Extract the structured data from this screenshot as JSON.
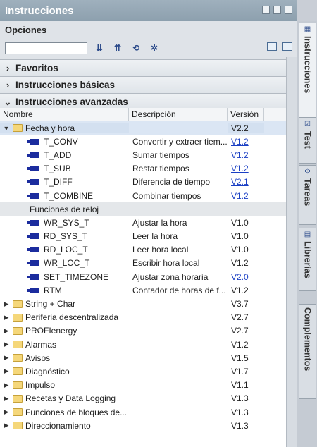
{
  "panel": {
    "title": "Instrucciones"
  },
  "options": {
    "label": "Opciones",
    "search_placeholder": ""
  },
  "panes": [
    {
      "label": "Favoritos",
      "expanded": false
    },
    {
      "label": "Instrucciones básicas",
      "expanded": false
    },
    {
      "label": "Instrucciones avanzadas",
      "expanded": true
    }
  ],
  "columns": {
    "name": "Nombre",
    "desc": "Descripción",
    "ver": "Versión"
  },
  "rows": [
    {
      "kind": "folder",
      "open": true,
      "name": "Fecha y hora",
      "desc": "",
      "ver": "V2.2",
      "link": false,
      "selected": true
    },
    {
      "kind": "block",
      "name": "T_CONV",
      "desc": "Convertir y extraer tiem...",
      "ver": "V1.2",
      "link": true
    },
    {
      "kind": "block",
      "name": "T_ADD",
      "desc": "Sumar tiempos",
      "ver": "V1.2",
      "link": true
    },
    {
      "kind": "block",
      "name": "T_SUB",
      "desc": "Restar tiempos",
      "ver": "V1.2",
      "link": true
    },
    {
      "kind": "block",
      "name": "T_DIFF",
      "desc": "Diferencia de tiempo",
      "ver": "V2.1",
      "link": true
    },
    {
      "kind": "block",
      "name": "T_COMBINE",
      "desc": "Combinar tiempos",
      "ver": "V1.2",
      "link": true
    },
    {
      "kind": "group",
      "name": "Funciones de reloj",
      "desc": "",
      "ver": ""
    },
    {
      "kind": "block",
      "name": "WR_SYS_T",
      "desc": "Ajustar la hora",
      "ver": "V1.0",
      "link": false
    },
    {
      "kind": "block",
      "name": "RD_SYS_T",
      "desc": "Leer la hora",
      "ver": "V1.0",
      "link": false
    },
    {
      "kind": "block",
      "name": "RD_LOC_T",
      "desc": "Leer hora local",
      "ver": "V1.0",
      "link": false
    },
    {
      "kind": "block",
      "name": "WR_LOC_T",
      "desc": "Escribir hora local",
      "ver": "V1.2",
      "link": false
    },
    {
      "kind": "block",
      "name": "SET_TIMEZONE",
      "desc": "Ajustar zona horaria",
      "ver": "V2.0",
      "link": true
    },
    {
      "kind": "block",
      "name": "RTM",
      "desc": "Contador de horas de f...",
      "ver": "V1.2",
      "link": false
    },
    {
      "kind": "folder",
      "open": false,
      "name": "String + Char",
      "desc": "",
      "ver": "V3.7",
      "link": false
    },
    {
      "kind": "folder",
      "open": false,
      "name": "Periferia descentralizada",
      "desc": "",
      "ver": "V2.7",
      "link": false
    },
    {
      "kind": "folder",
      "open": false,
      "name": "PROFIenergy",
      "desc": "",
      "ver": "V2.7",
      "link": false
    },
    {
      "kind": "folder",
      "open": false,
      "name": "Alarmas",
      "desc": "",
      "ver": "V1.2",
      "link": false
    },
    {
      "kind": "folder",
      "open": false,
      "name": "Avisos",
      "desc": "",
      "ver": "V1.5",
      "link": false
    },
    {
      "kind": "folder",
      "open": false,
      "name": "Diagnóstico",
      "desc": "",
      "ver": "V1.7",
      "link": false
    },
    {
      "kind": "folder",
      "open": false,
      "name": "Impulso",
      "desc": "",
      "ver": "V1.1",
      "link": false
    },
    {
      "kind": "folder",
      "open": false,
      "name": "Recetas y Data Logging",
      "desc": "",
      "ver": "V1.3",
      "link": false
    },
    {
      "kind": "folder",
      "open": false,
      "name": "Funciones de bloques de...",
      "desc": "",
      "ver": "V1.3",
      "link": false
    },
    {
      "kind": "folder",
      "open": false,
      "name": "Direccionamiento",
      "desc": "",
      "ver": "V1.3",
      "link": false
    }
  ],
  "side_tabs": [
    {
      "label": "Instrucciones",
      "active": true
    },
    {
      "label": "Test",
      "active": false
    },
    {
      "label": "Tareas",
      "active": false
    },
    {
      "label": "Librerías",
      "active": false
    },
    {
      "label": "Complementos",
      "active": false
    }
  ],
  "colors": {
    "link": "#1a3fc4",
    "block": "#1b2c9e",
    "folder": "#f5d77a",
    "selected": "#d3e0f0"
  }
}
